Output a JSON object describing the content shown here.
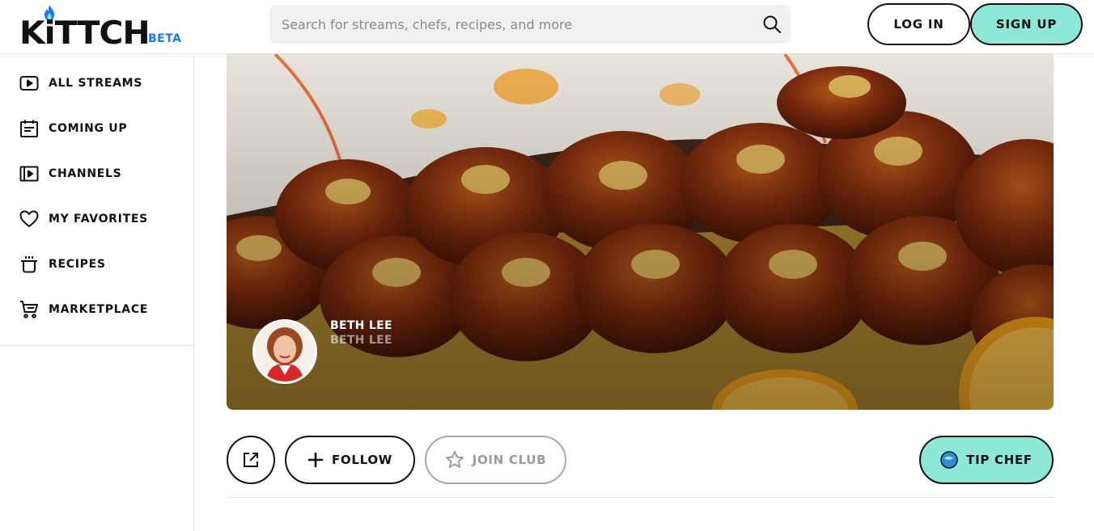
{
  "header": {
    "logo_text": "KiTTCH",
    "logo_badge": "BETA",
    "search": {
      "placeholder": "Search for streams, chefs, recipes, and more",
      "icon": "search-icon"
    },
    "login_label": "LOG IN",
    "signup_label": "SIGN UP"
  },
  "sidebar": {
    "items": [
      {
        "label": "ALL STREAMS",
        "icon": "play-icon"
      },
      {
        "label": "COMING UP",
        "icon": "calendar-icon"
      },
      {
        "label": "CHANNELS",
        "icon": "channels-icon"
      },
      {
        "label": "MY FAVORITES",
        "icon": "heart-icon"
      },
      {
        "label": "RECIPES",
        "icon": "pot-icon"
      },
      {
        "label": "MARKETPLACE",
        "icon": "cart-icon"
      }
    ]
  },
  "channel": {
    "chef_name": "BETH LEE",
    "chef_handle": "BETH LEE"
  },
  "actions": {
    "follow_label": "FOLLOW",
    "join_label": "JOIN CLUB",
    "tip_label": "TIP CHEF"
  },
  "colors": {
    "accent": "#8ee8d8",
    "brand_blue": "#1677ff",
    "text": "#111111",
    "disabled": "#9b9b9b"
  }
}
